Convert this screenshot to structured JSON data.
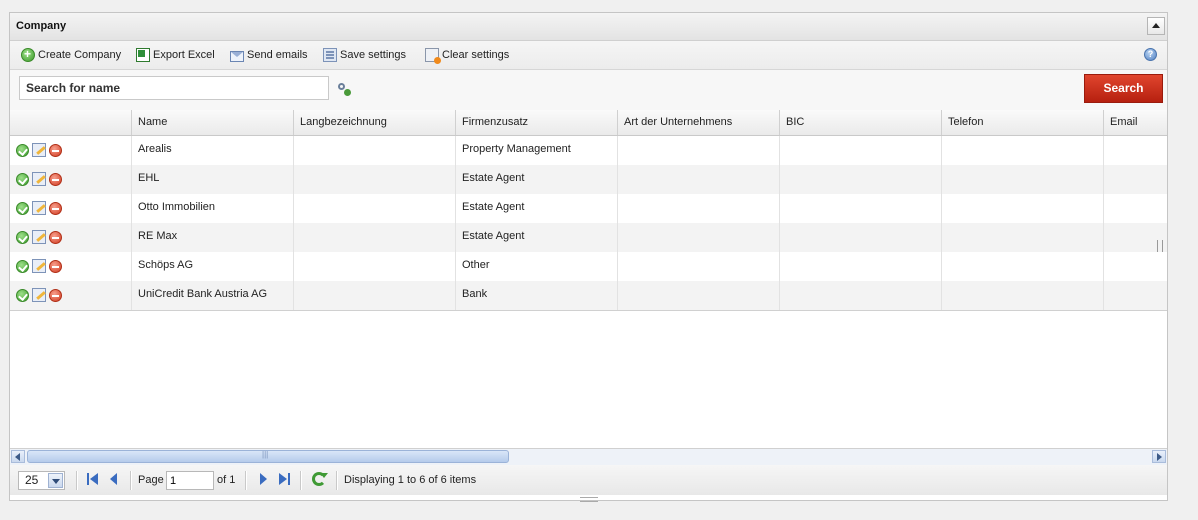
{
  "panel": {
    "title": "Company"
  },
  "toolbar": {
    "create": "Create Company",
    "export": "Export Excel",
    "send": "Send emails",
    "save": "Save settings",
    "clear": "Clear settings"
  },
  "search": {
    "placeholder": "Search for name",
    "button": "Search"
  },
  "columns": [
    "",
    "Name",
    "Langbezeichnung",
    "Firmenzusatz",
    "Art der Unternehmens",
    "BIC",
    "Telefon",
    "Email"
  ],
  "rows": [
    {
      "name": "Arealis",
      "lang": "",
      "zusatz": "Property Management",
      "art": "",
      "bic": "",
      "tel": "",
      "email": ""
    },
    {
      "name": "EHL",
      "lang": "",
      "zusatz": "Estate Agent",
      "art": "",
      "bic": "",
      "tel": "",
      "email": ""
    },
    {
      "name": "Otto Immobilien",
      "lang": "",
      "zusatz": "Estate Agent",
      "art": "",
      "bic": "",
      "tel": "",
      "email": ""
    },
    {
      "name": "RE Max",
      "lang": "",
      "zusatz": "Estate Agent",
      "art": "",
      "bic": "",
      "tel": "",
      "email": ""
    },
    {
      "name": "Schöps AG",
      "lang": "",
      "zusatz": "Other",
      "art": "",
      "bic": "",
      "tel": "",
      "email": ""
    },
    {
      "name": "UniCredit Bank Austria AG",
      "lang": "",
      "zusatz": "Bank",
      "art": "",
      "bic": "",
      "tel": "",
      "email": ""
    }
  ],
  "pager": {
    "page_size": "25",
    "page_label": "Page",
    "page_value": "1",
    "of_label": "of 1",
    "display": "Displaying 1 to 6 of 6 items"
  },
  "colors": {
    "search_button": "#c9281a",
    "accent_blue": "#3a6cc0"
  }
}
